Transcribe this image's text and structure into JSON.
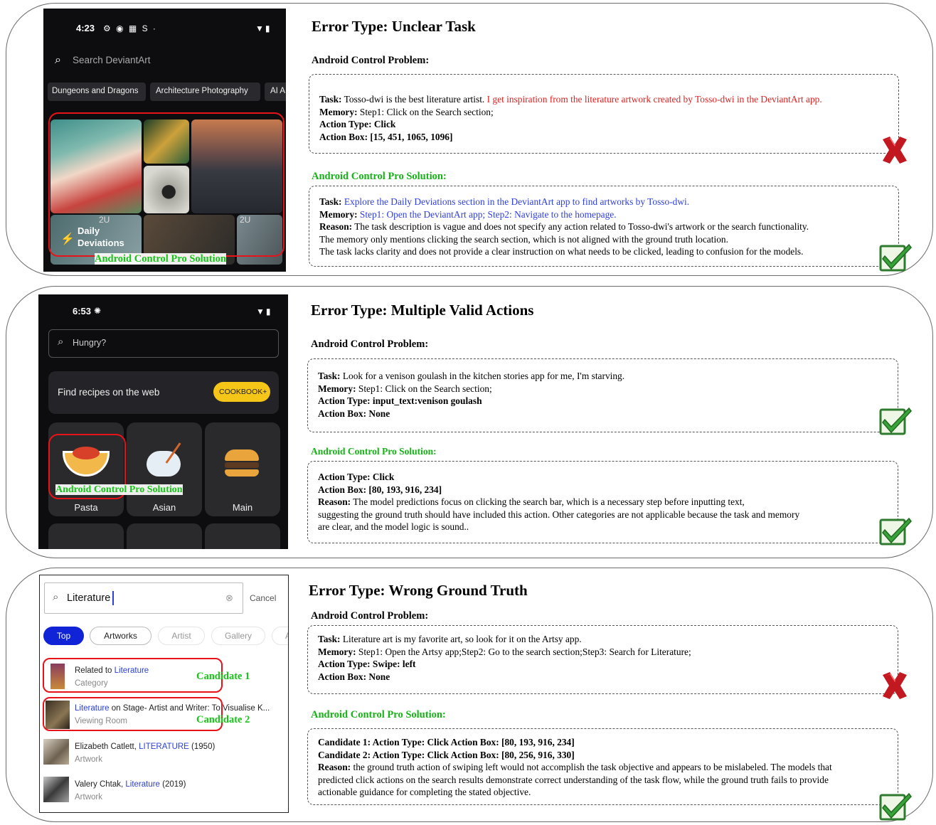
{
  "panel1": {
    "phone": {
      "time": "4:23",
      "status_icons": "⚙ ◉ ▦ S ·",
      "search_placeholder": "Search DeviantArt",
      "chips": [
        "Dungeons and Dragons",
        "Architecture Photography",
        "AI A"
      ],
      "daily_label_1": "Daily",
      "daily_label_2": "Deviations",
      "thumb_tag_1": "2U",
      "thumb_tag_2": "2U",
      "overlay": "Android Control Pro Solution"
    },
    "heading": "Error Type: Unclear Task",
    "problem_title": "Android Control Problem:",
    "problem": {
      "task_label": "Task:",
      "task_plain": " Tosso-dwi is the best literature artist.",
      "task_red": " I get inspiration from the literature artwork created by Tosso-dwi in the DeviantArt app.",
      "memory_label": "Memory:",
      "memory": " Step1: Click on the Search section;",
      "action_type": "Action Type: Click",
      "action_box": "Action Box: [15, 451, 1065, 1096]"
    },
    "solution_title": "Android Control Pro Solution:",
    "solution": {
      "task_label": "Task:",
      "task_blue": " Explore the Daily Deviations section in the DeviantArt app to find artworks by Tosso-dwi.",
      "memory_label": "Memory:",
      "memory_blue": " Step1: Open the DeviantArt app; Step2: Navigate to the homepage.",
      "reason_label": "Reason:",
      "reason_1": " The task description is vague and does not specify any action related to Tosso-dwi's artwork or the search functionality.",
      "reason_2": "The memory only mentions clicking the search section, which is not aligned with the ground truth location.",
      "reason_3": "The task lacks clarity and does not provide a clear instruction on what needs to be clicked, leading to confusion for the models."
    }
  },
  "panel2": {
    "phone": {
      "time": "6:53",
      "search_placeholder": "Hungry?",
      "banner_text": "Find recipes on the web",
      "banner_button": "COOKBOOK+",
      "tiles": [
        "Pasta",
        "Asian",
        "Main"
      ],
      "overlay": "Android Control Pro Solution"
    },
    "heading": "Error Type: Multiple Valid Actions",
    "problem_title": "Android Control Problem:",
    "problem": {
      "task_label": "Task:",
      "task": " Look for a venison goulash in the kitchen stories app for me, I'm starving.",
      "memory_label": "Memory:",
      "memory": " Step1: Click on the Search section;",
      "action_type": "Action Type: input_text:venison goulash",
      "action_box": "Action Box: None"
    },
    "solution_title": "Android Control Pro Solution:",
    "solution": {
      "action_type": "Action Type: Click",
      "action_box": "Action Box: [80, 193, 916, 234]",
      "reason_label": "Reason:",
      "reason_1": " The model predictions focus on clicking the search bar, which is a necessary step before inputting text,",
      "reason_2": "suggesting the ground truth should have included this action. Other categories are not applicable because the task and memory",
      "reason_3": "are clear, and the model logic is sound.."
    }
  },
  "panel3": {
    "phone": {
      "search_value": "Literature",
      "cancel": "Cancel",
      "tabs": [
        "Top",
        "Artworks",
        "Artist",
        "Gallery",
        "A"
      ],
      "results": [
        {
          "pre": "Related to ",
          "hl": "Literature",
          "post": "",
          "sub": "Category"
        },
        {
          "pre": "",
          "hl": "Literature",
          "post": " on Stage- Artist and Writer: To Visualise K...",
          "sub": "Viewing Room"
        },
        {
          "pre": "Elizabeth Catlett, ",
          "hl": "LITERATURE",
          "post": " (1950)",
          "sub": "Artwork"
        },
        {
          "pre": "Valery Chtak, ",
          "hl": "Literature",
          "post": " (2019)",
          "sub": "Artwork"
        }
      ],
      "candidate_1": "Candidate 1",
      "candidate_2": "Candidate 2"
    },
    "heading": "Error Type: Wrong Ground Truth",
    "problem_title": "Android Control Problem:",
    "problem": {
      "task_label": "Task:",
      "task": " Literature art is my favorite art, so look for it on the Artsy app.",
      "memory_label": "Memory:",
      "memory": " Step1: Open the Artsy app;Step2: Go to the search section;Step3: Search for Literature;",
      "action_type": "Action Type: Swipe: left",
      "action_box": "Action Box: None"
    },
    "solution_title": "Android Control Pro Solution:",
    "solution": {
      "cand1": "Candidate 1: Action Type: Click Action Box: [80, 193, 916, 234]",
      "cand2": "Candidate 2: Action Type: Click Action Box: [80, 256, 916, 330]",
      "reason_label": "Reason:",
      "reason_1": " the ground truth action of swiping left would not accomplish the task objective and appears to be mislabeled. The models that",
      "reason_2": "predicted click actions on the search results demonstrate correct understanding of the task flow, while the ground truth fails to provide",
      "reason_3": "actionable guidance for completing the stated objective."
    }
  },
  "colors": {
    "red": "#e02020",
    "blue": "#2f3fe0",
    "green": "#17b217",
    "highlight_box": "#e8131a"
  },
  "icons": {
    "wrong": "cross-mark-icon",
    "right": "check-mark-icon"
  }
}
